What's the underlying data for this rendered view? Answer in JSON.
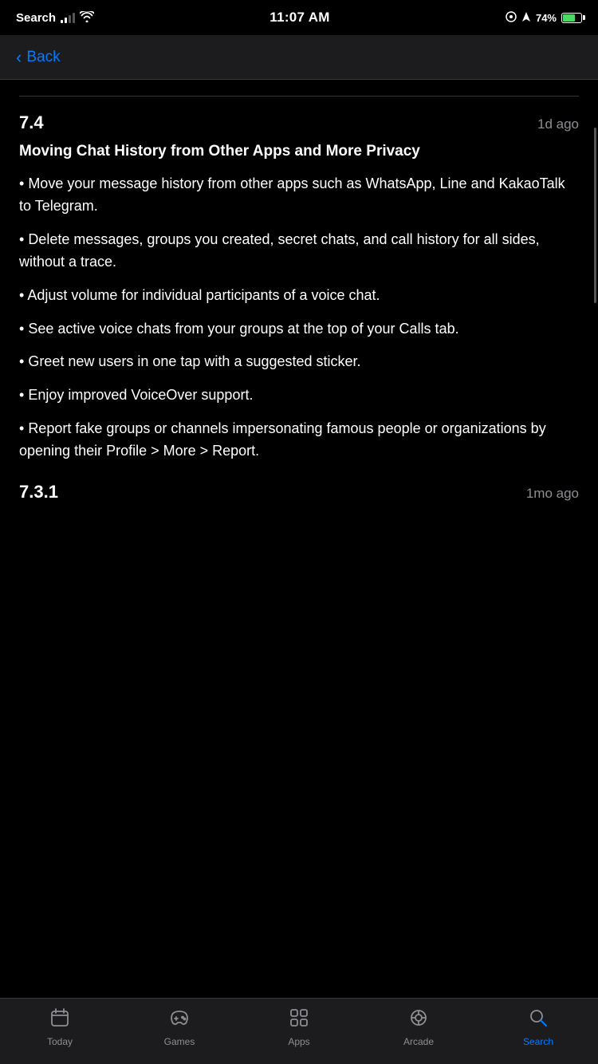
{
  "statusBar": {
    "carrier": "Search",
    "time": "11:07 AM",
    "battery_percent": "74%"
  },
  "navBar": {
    "back_label": "Back"
  },
  "versions": [
    {
      "number": "7.4",
      "time_ago": "1d ago",
      "title": "Moving Chat History from Other Apps and More Privacy",
      "bullets": [
        "Move your message history from other apps such as WhatsApp, Line and KakaoTalk to Telegram.",
        "Delete messages, groups you created, secret chats, and call history for all sides, without a trace.",
        "Adjust volume for individual participants of a voice chat.",
        "See active voice chats from your groups at the top of your Calls tab.",
        "Greet new users in one tap with a suggested sticker.",
        "Enjoy improved VoiceOver support.",
        "Report fake groups or channels impersonating famous people or organizations by opening their Profile > More > Report."
      ]
    },
    {
      "number": "7.3.1",
      "time_ago": "1mo ago"
    }
  ],
  "tabBar": {
    "items": [
      {
        "id": "today",
        "label": "Today",
        "active": false
      },
      {
        "id": "games",
        "label": "Games",
        "active": false
      },
      {
        "id": "apps",
        "label": "Apps",
        "active": false
      },
      {
        "id": "arcade",
        "label": "Arcade",
        "active": false
      },
      {
        "id": "search",
        "label": "Search",
        "active": true
      }
    ]
  }
}
